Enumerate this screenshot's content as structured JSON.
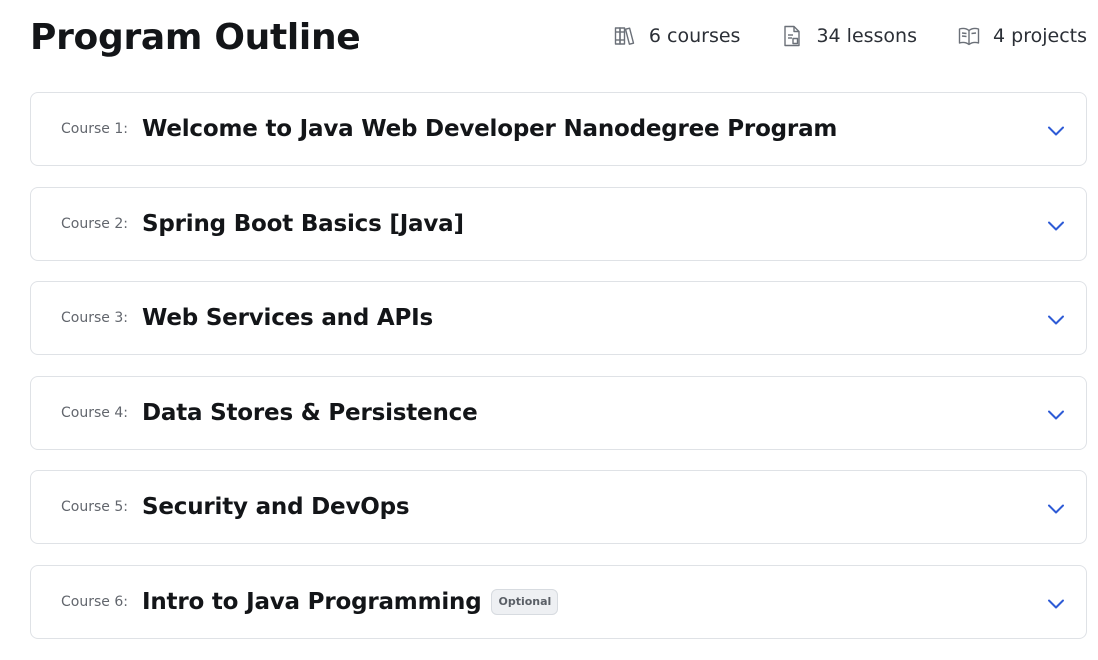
{
  "header": {
    "title": "Program Outline",
    "stats": [
      {
        "icon": "library-books-icon",
        "label": "6 courses"
      },
      {
        "icon": "lesson-document-icon",
        "label": "34 lessons"
      },
      {
        "icon": "open-book-icon",
        "label": "4 projects"
      }
    ]
  },
  "courses": [
    {
      "prefix": "Course 1:",
      "title": "Welcome to Java Web Developer Nanodegree Program",
      "badge": ""
    },
    {
      "prefix": "Course 2:",
      "title": "Spring Boot Basics [Java]",
      "badge": ""
    },
    {
      "prefix": "Course 3:",
      "title": "Web Services and APIs",
      "badge": ""
    },
    {
      "prefix": "Course 4:",
      "title": "Data Stores & Persistence",
      "badge": ""
    },
    {
      "prefix": "Course 5:",
      "title": "Security and DevOps",
      "badge": ""
    },
    {
      "prefix": "Course 6:",
      "title": "Intro to Java Programming",
      "badge": "Optional"
    }
  ],
  "colors": {
    "accent": "#2e5bd6",
    "border": "#dfe2e6",
    "text": "#131518",
    "muted": "#62666d"
  }
}
